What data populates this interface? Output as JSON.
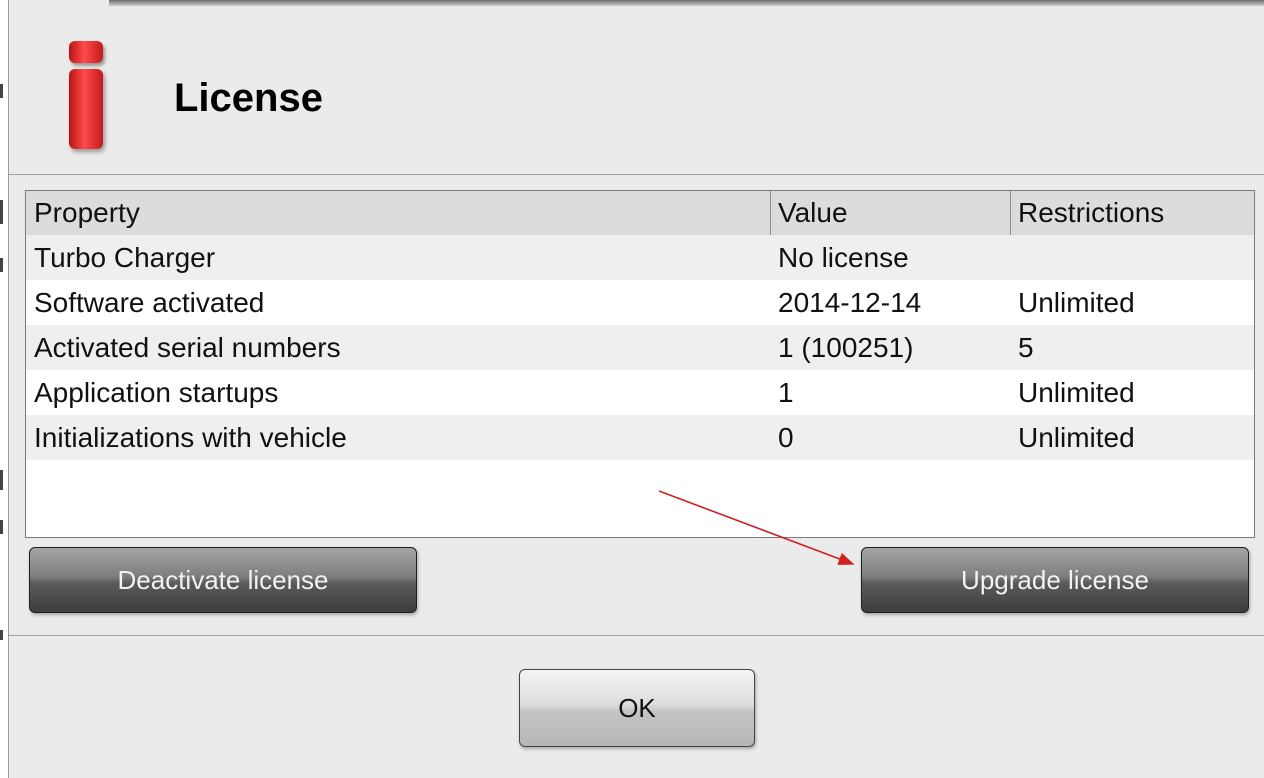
{
  "dialog": {
    "title": "License",
    "icon": "info-icon",
    "accent_color": "#e02020"
  },
  "table": {
    "headers": [
      "Property",
      "Value",
      "Restrictions"
    ],
    "rows": [
      [
        "Turbo Charger",
        "No license",
        ""
      ],
      [
        "Software activated",
        "2014-12-14",
        "Unlimited"
      ],
      [
        "Activated serial numbers",
        "1 (100251)",
        "5"
      ],
      [
        "Application startups",
        "1",
        "Unlimited"
      ],
      [
        "Initializations with vehicle",
        "0",
        "Unlimited"
      ]
    ]
  },
  "buttons": {
    "deactivate": "Deactivate license",
    "upgrade": "Upgrade license",
    "ok": "OK"
  },
  "annotation": {
    "arrow_color": "#d02020",
    "arrow_target": "upgrade-license-button"
  }
}
